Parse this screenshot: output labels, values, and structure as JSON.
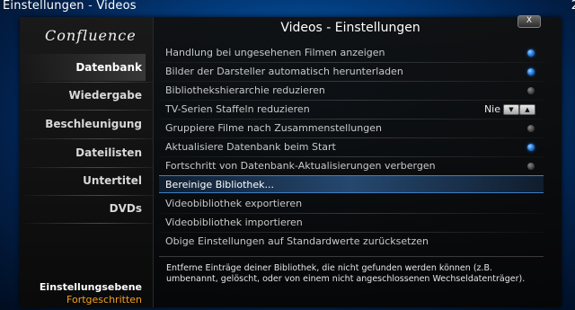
{
  "topbar": {
    "section": "Einstellungen",
    "separator": "-",
    "page": "Videos",
    "clock": "2"
  },
  "sidebar": {
    "logo": "Confluence",
    "items": [
      {
        "label": "Datenbank",
        "active": true
      },
      {
        "label": "Wiedergabe",
        "active": false
      },
      {
        "label": "Beschleunigung",
        "active": false
      },
      {
        "label": "Dateilisten",
        "active": false
      },
      {
        "label": "Untertitel",
        "active": false
      },
      {
        "label": "DVDs",
        "active": false
      }
    ],
    "level_label": "Einstellungsebene",
    "level_value": "Fortgeschritten"
  },
  "dialog": {
    "title": "Videos - Einstellungen",
    "close_label": "X"
  },
  "settings": [
    {
      "label": "Handlung bei ungesehenen Filmen anzeigen",
      "control": "radio",
      "state": "on"
    },
    {
      "label": "Bilder der Darsteller automatisch herunterladen",
      "control": "radio",
      "state": "on"
    },
    {
      "label": "Bibliothekshierarchie reduzieren",
      "control": "radio",
      "state": "off"
    },
    {
      "label": "TV-Serien Staffeln reduzieren",
      "control": "spinner",
      "value": "Nie"
    },
    {
      "label": "Gruppiere Filme nach Zusammenstellungen",
      "control": "radio",
      "state": "off"
    },
    {
      "label": "Aktualisiere Datenbank beim Start",
      "control": "radio",
      "state": "on"
    },
    {
      "label": "Fortschritt von Datenbank-Aktualisierungen verbergen",
      "control": "radio",
      "state": "off"
    },
    {
      "label": "Bereinige Bibliothek...",
      "control": "none",
      "selected": true
    },
    {
      "label": "Videobibliothek exportieren",
      "control": "none"
    },
    {
      "label": "Videobibliothek importieren",
      "control": "none"
    },
    {
      "label": "Obige Einstellungen auf Standardwerte zurücksetzen",
      "control": "none"
    }
  ],
  "spinner": {
    "down_icon": "triangle-down",
    "up_icon": "triangle-up"
  },
  "description": "Entferne Einträge deiner Bibliothek, die nicht gefunden werden können (z.B. umbenannt, gelöscht, oder von einem nicht angeschlossenen Wechseldatenträger).",
  "colors": {
    "accent": "#2b82e0",
    "level_value": "#f0a020"
  }
}
